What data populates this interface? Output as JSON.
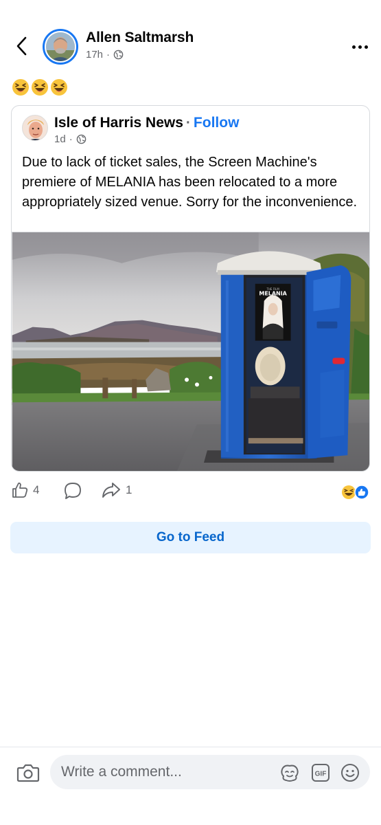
{
  "header": {
    "author_name": "Allen Saltmarsh",
    "time_ago": "17h",
    "separator": "·"
  },
  "post": {
    "emojis": [
      "laughing-emoji",
      "laughing-emoji",
      "laughing-emoji"
    ]
  },
  "shared_post": {
    "page_name": "Isle of Harris News",
    "separator": "·",
    "follow_label": "Follow",
    "time_ago": "1d",
    "body": "Due to lack of ticket sales, the Screen Machine's premiere of MELANIA has been relocated to a more appropriately sized venue. Sorry for the inconvenience.",
    "poster_title": "MELANIA",
    "poster_kicker": "THE FILM"
  },
  "actions": {
    "like_count": "4",
    "share_count": "1",
    "reactions": [
      "laugh-reaction",
      "like-reaction"
    ]
  },
  "feed_button": {
    "label": "Go to Feed"
  },
  "comment_bar": {
    "placeholder": "Write a comment...",
    "gif_label": "GIF"
  },
  "colors": {
    "accent": "#1877f2",
    "feed_button_bg": "#e7f3ff",
    "feed_button_text": "#0866cc",
    "secondary_text": "#65676b",
    "toilet_blue": "#1f5bb8"
  }
}
